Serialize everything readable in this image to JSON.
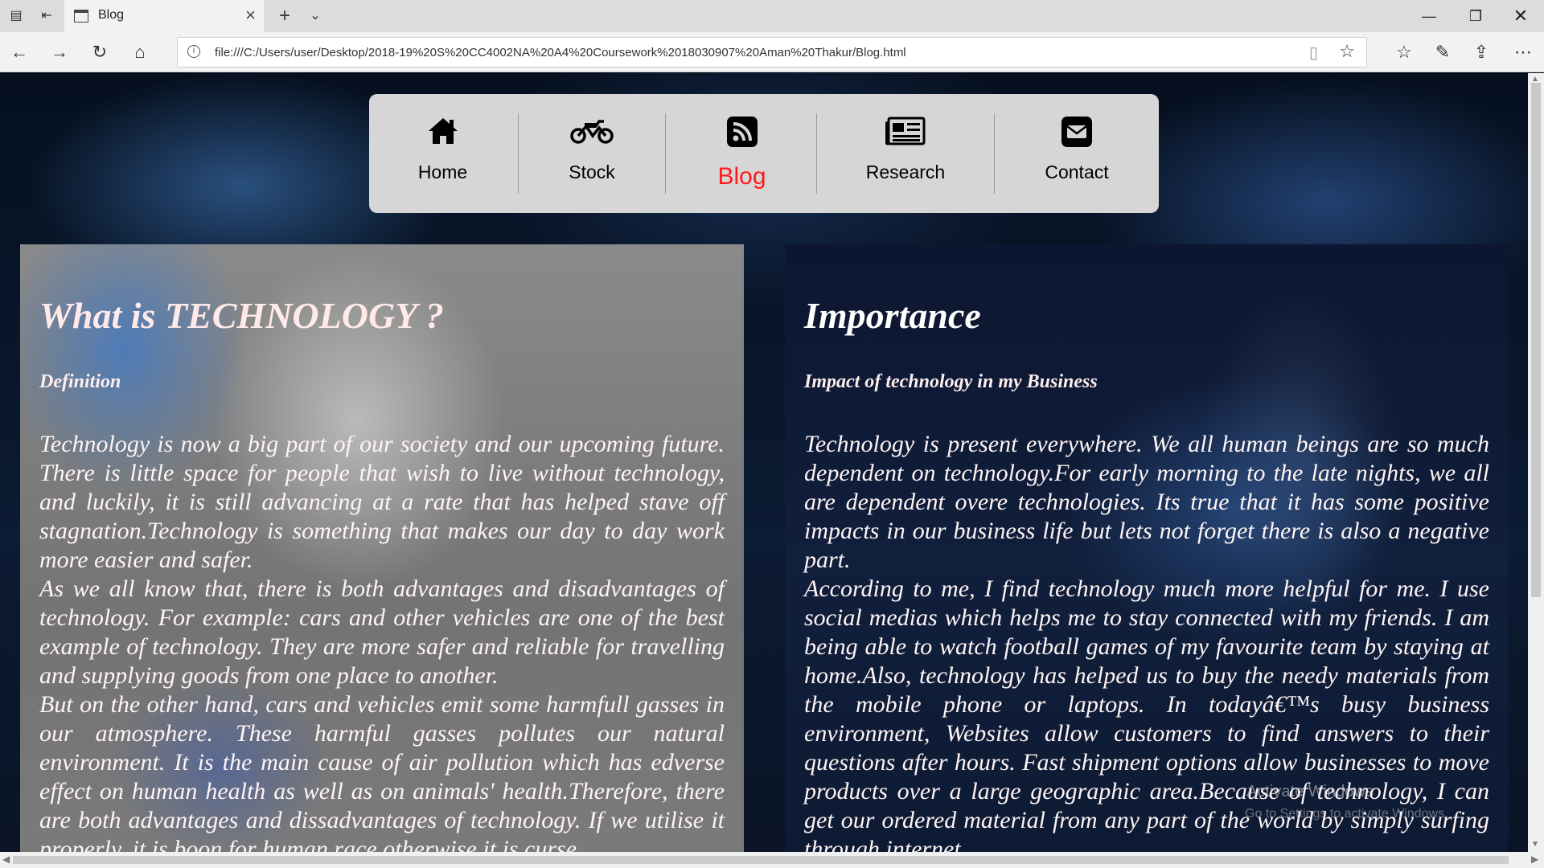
{
  "browser": {
    "tab_title": "Blog",
    "new_tab": "+",
    "url": "file:///C:/Users/user/Desktop/2018-19%20S%20CC4002NA%20A4%20Coursework%2018030907%20Aman%20Thakur/Blog.html"
  },
  "nav": {
    "items": [
      {
        "label": "Home",
        "icon": "home-icon"
      },
      {
        "label": "Stock",
        "icon": "motorcycle-icon"
      },
      {
        "label": "Blog",
        "icon": "rss-icon"
      },
      {
        "label": "Research",
        "icon": "newspaper-icon"
      },
      {
        "label": "Contact",
        "icon": "envelope-icon"
      }
    ],
    "active_color": "#ff1a1a"
  },
  "left": {
    "title": "What is TECHNOLOGY ?",
    "subtitle": "Definition",
    "paragraphs": [
      "Technology is now a big part of our society and our upcoming future. There is little space for people that wish to live without technology, and luckily, it is still advancing at a rate that has helped stave off stagnation.Technology is something that makes our day to day work more easier and safer.",
      "As we all know that, there is both advantages and disadvantages of technology. For example: cars and other vehicles are one of the best example of technology. They are more safer and reliable for travelling and supplying goods from one place to another.",
      "But on the other hand, cars and vehicles emit some harmfull gasses in our atmosphere. These harmful gasses pollutes our natural environment. It is the main cause of air pollution which has edverse effect on human health as well as on animals' health.Therefore, there are both advantages and dissadvantages of technology. If we utilise it properly, it is boon for human race otherwise it is curse."
    ]
  },
  "right": {
    "title": "Importance",
    "subtitle": "Impact of technology in my Business",
    "paragraphs": [
      "Technology is present everywhere. We all human beings are so much dependent on technology.For early morning to the late nights, we all are dependent overe technologies. Its true that it has some positive impacts in our business life but lets not forget there is also a negative part.",
      "According to me, I find technology much more helpful for me. I use social medias which helps me to stay connected with my friends. I am being able to watch football games of my favourite team by staying at home.Also, technology has helped us to buy the needy materials from the mobile phone or laptops. In todayâ€™s busy business environment, Websites allow customers to find answers to their questions after hours. Fast shipment options allow businesses to move products over a large geographic area.Because of technology, I can get our ordered material from any part of the world by simply surfing through internet."
    ]
  },
  "watermark": {
    "line1": "Activate Windows",
    "line2": "Go to Settings to activate Windows."
  }
}
